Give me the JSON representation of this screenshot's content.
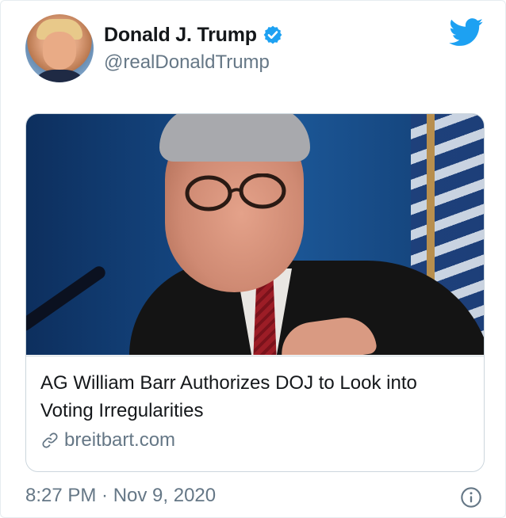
{
  "tweet": {
    "author_name": "Donald J. Trump",
    "author_handle": "@realDonaldTrump",
    "verified": true,
    "avatar_icon": "profile-photo",
    "platform_icon": "twitter-bird-icon",
    "timestamp": "8:27 PM · Nov 9, 2020",
    "colors": {
      "twitter_blue": "#1da1f2",
      "text_primary": "#14171a",
      "text_secondary": "#657786",
      "border": "#ccd6dd"
    }
  },
  "card": {
    "title": "AG William Barr Authorizes DOJ to Look into Voting Irregularities",
    "domain": "breitbart.com",
    "link_icon": "link-icon"
  }
}
